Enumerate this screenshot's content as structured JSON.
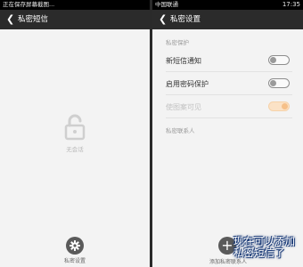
{
  "left_screen": {
    "status_text": "正在保存屏幕截图...",
    "title": "私密短信",
    "empty_caption": "无会话",
    "bottom_button_label": "私密设置"
  },
  "right_screen": {
    "carrier": "中国联通",
    "clock": "17:35",
    "title": "私密设置",
    "section_privacy": "私密保护",
    "row_new_sms_notify": {
      "label": "新短信通知",
      "enabled": false
    },
    "row_password_protect": {
      "label": "启用密码保护",
      "enabled": false
    },
    "row_pattern_protect": {
      "label": "使图案可见",
      "enabled": true,
      "disabled": true
    },
    "section_contacts": "私密联系人",
    "add_button_label": "添加私密联系人",
    "overlay_caption": "现在可以添加私密短信了"
  },
  "colors": {
    "title_bar": "#2b2b2b",
    "background": "#f3f3f3",
    "toggle_on": "#f6c089"
  },
  "icons": [
    "back-arrow-icon",
    "lock-open-icon",
    "gear-icon",
    "plus-icon"
  ]
}
